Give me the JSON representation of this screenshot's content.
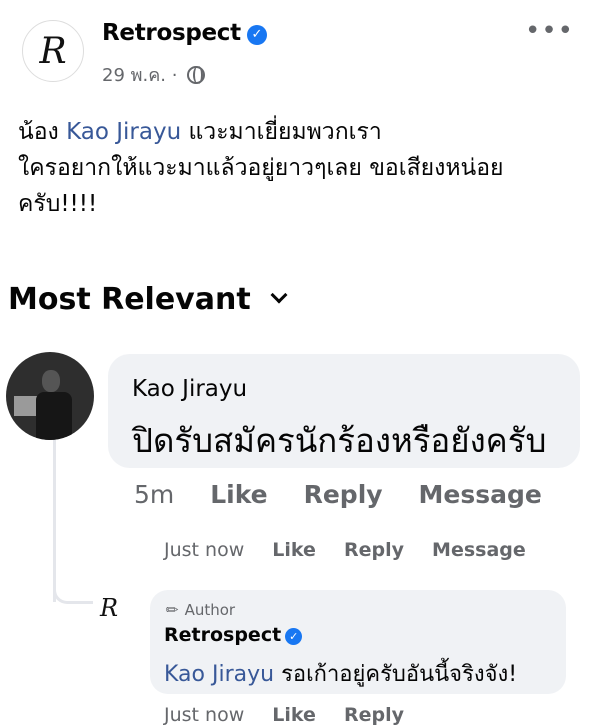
{
  "post": {
    "page_name": "Retrospect",
    "avatar_monogram": "R",
    "date": "29 พ.ค.",
    "separator": "·",
    "audience_icon": "globe-icon",
    "more_icon": "•••",
    "text_prefix": "น้อง ",
    "text_mention": "Kao Jirayu",
    "text_line1_rest": " แวะมาเยี่ยมพวกเรา",
    "text_line2": "ใครอยากให้แวะมาแล้วอยู่ยาวๆเลย ขอเสียงหน่อย",
    "text_line3": "ครับ!!!!"
  },
  "comments_sort": {
    "label": "Most Relevant"
  },
  "comment": {
    "author": "Kao Jirayu",
    "text": "ปิดรับสมัครนักร้องหรือยังครับ",
    "actions": {
      "time": "5m",
      "like": "Like",
      "reply": "Reply",
      "message": "Message"
    },
    "sub_actions": {
      "time": "Just now",
      "like": "Like",
      "reply": "Reply",
      "message": "Message"
    }
  },
  "reply": {
    "avatar_monogram": "R",
    "badge": "Author",
    "author": "Retrospect",
    "mention": "Kao Jirayu",
    "text": " รอเก้าอยู่ครับอันนี้จริงจัง!",
    "actions": {
      "time": "Just now",
      "like": "Like",
      "reply": "Reply"
    }
  },
  "colors": {
    "verified": "#1877f2",
    "mention": "#385898",
    "bubble": "#f0f2f5",
    "secondary_text": "#65676b"
  }
}
